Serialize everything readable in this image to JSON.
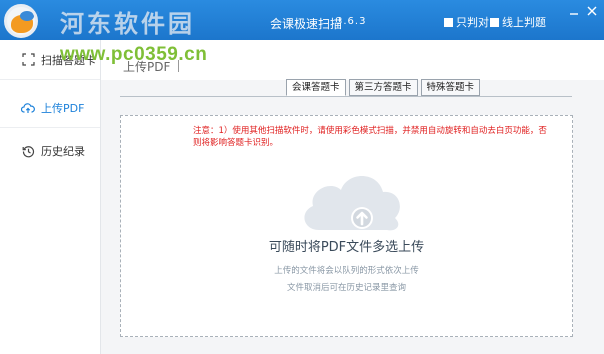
{
  "watermark": {
    "text": "河东软件园",
    "url": "www.pc0359.cn"
  },
  "titlebar": {
    "title": "会课极速扫描",
    "version": "3.6.3",
    "options": [
      {
        "label": "只判对",
        "checked": true
      },
      {
        "label": "线上判题",
        "checked": true
      }
    ],
    "accent": "#1e82da"
  },
  "sidebar": {
    "items": [
      {
        "label": "扫描答题卡",
        "icon": "scan-icon",
        "active": false
      },
      {
        "label": "上传PDF",
        "icon": "cloud-upload-icon",
        "active": true
      },
      {
        "label": "历史纪录",
        "icon": "history-icon",
        "active": false
      }
    ]
  },
  "main": {
    "heading": "上传PDF",
    "tabs": [
      {
        "label": "会课答题卡",
        "active": true
      },
      {
        "label": "第三方答题卡",
        "active": false
      },
      {
        "label": "特殊答题卡",
        "active": false
      }
    ],
    "notice": "注意：1）使用其他扫描软件时，请使用彩色模式扫描，并禁用自动旋转和自动去白页功能，否则将影响答题卡识别。",
    "drop_title": "可随时将PDF文件多选上传",
    "drop_sub1": "上传的文件将会以队列的形式依次上传",
    "drop_sub2": "文件取消后可在历史记录里查询"
  }
}
